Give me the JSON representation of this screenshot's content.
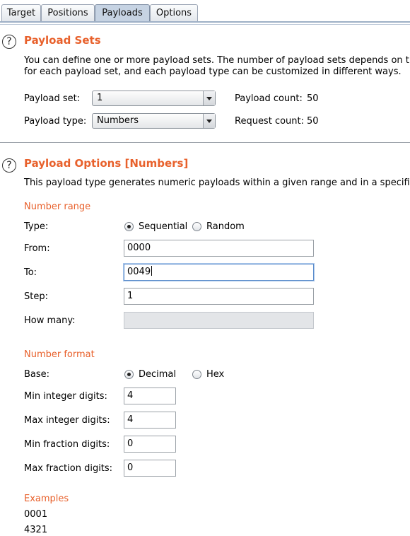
{
  "tabs": [
    "Target",
    "Positions",
    "Payloads",
    "Options"
  ],
  "active_tab": "Payloads",
  "payload_sets": {
    "help_icon": "?",
    "title": "Payload Sets",
    "desc_line1": "You can define one or more payload sets. The number of payload sets depends on th",
    "desc_line2": "for each payload set, and each payload type can be customized in different ways.",
    "set_label": "Payload set:",
    "set_value": "1",
    "type_label": "Payload type:",
    "type_value": "Numbers",
    "count_label": "Payload count:",
    "count_value": "50",
    "request_label": "Request count:",
    "request_value": "50"
  },
  "payload_options": {
    "help_icon": "?",
    "title": "Payload Options [Numbers]",
    "desc": "This payload type generates numeric payloads within a given range and in a specifi",
    "number_range": {
      "heading": "Number range",
      "type_label": "Type:",
      "sequential_label": "Sequential",
      "random_label": "Random",
      "selected": "Sequential",
      "from_label": "From:",
      "from_value": "0000",
      "to_label": "To:",
      "to_value": "0049",
      "step_label": "Step:",
      "step_value": "1",
      "howmany_label": "How many:",
      "howmany_value": ""
    },
    "number_format": {
      "heading": "Number format",
      "base_label": "Base:",
      "decimal_label": "Decimal",
      "hex_label": "Hex",
      "selected": "Decimal",
      "min_int_label": "Min integer digits:",
      "min_int_value": "4",
      "max_int_label": "Max integer digits:",
      "max_int_value": "4",
      "min_frac_label": "Min fraction digits:",
      "min_frac_value": "0",
      "max_frac_label": "Max fraction digits:",
      "max_frac_value": "0"
    },
    "examples": {
      "heading": "Examples",
      "items": [
        "0001",
        "4321"
      ]
    }
  }
}
